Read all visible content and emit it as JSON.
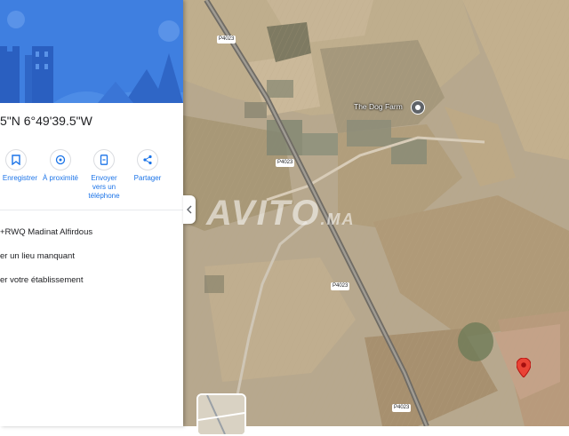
{
  "panel": {
    "coordinates": "5\"N 6°49'39.5\"W",
    "actions": [
      {
        "label": "Enregistrer",
        "icon": "bookmark-icon"
      },
      {
        "label": "À proximité",
        "icon": "nearby-icon"
      },
      {
        "label": "Envoyer vers un téléphone",
        "icon": "send-to-phone-icon"
      },
      {
        "label": "Partager",
        "icon": "share-icon"
      }
    ],
    "plus_code": "+RWQ Madinat Alfirdous",
    "add_place": "er un lieu manquant",
    "add_business": "er votre établissement"
  },
  "map": {
    "road_labels": [
      "P4023",
      "P4023",
      "P4023",
      "P4023"
    ],
    "poi_name": "The Dog Farm",
    "watermark": "AVITO",
    "watermark_suffix": ".MA"
  },
  "colors": {
    "accent": "#1a73e8",
    "marker": "#ea4335",
    "hero": "#3f7fe0"
  }
}
